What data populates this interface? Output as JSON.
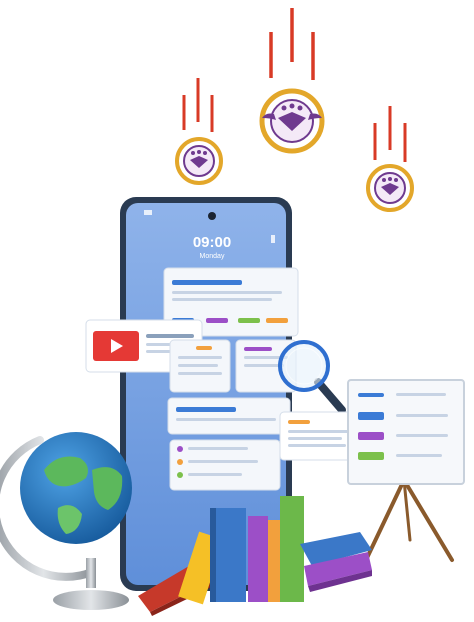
{
  "phone": {
    "time": "09:00",
    "day": "Monday"
  },
  "icons": {
    "coins": "falling-emblem-coin-icon",
    "video": "video-play-icon",
    "search": "magnifying-glass-icon",
    "globe": "globe-icon",
    "easel": "presentation-easel-icon",
    "books": "book-stack-icon"
  },
  "colors": {
    "phone_body": "#8fb8ea",
    "phone_frame": "#2a3b52",
    "coin_ring": "#e3a72a",
    "coin_inner": "#6f3a8f",
    "motion_lines": "#d83a26",
    "video_red": "#e53935",
    "accent_blue": "#3b7bd6",
    "accent_orange": "#f2a03d",
    "accent_purple": "#9c4fc7",
    "accent_green": "#7cc04b"
  }
}
